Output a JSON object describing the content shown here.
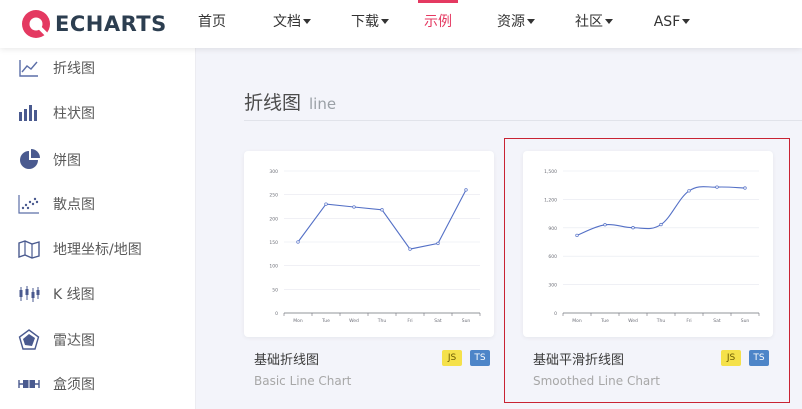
{
  "brand": {
    "name": "ECHARTS",
    "accent": "#e43961"
  },
  "nav": {
    "items": [
      {
        "label": "首页",
        "dropdown": false,
        "active": false
      },
      {
        "label": "文档",
        "dropdown": true,
        "active": false
      },
      {
        "label": "下载",
        "dropdown": true,
        "active": false
      },
      {
        "label": "示例",
        "dropdown": false,
        "active": true
      },
      {
        "label": "资源",
        "dropdown": true,
        "active": false
      },
      {
        "label": "社区",
        "dropdown": true,
        "active": false
      },
      {
        "label": "ASF",
        "dropdown": true,
        "active": false
      }
    ]
  },
  "sidebar": {
    "items": [
      {
        "label": "折线图",
        "icon": "line-chart-icon"
      },
      {
        "label": "柱状图",
        "icon": "bar-chart-icon"
      },
      {
        "label": "饼图",
        "icon": "pie-chart-icon"
      },
      {
        "label": "散点图",
        "icon": "scatter-chart-icon"
      },
      {
        "label": "地理坐标/地图",
        "icon": "map-icon"
      },
      {
        "label": "K 线图",
        "icon": "candlestick-icon"
      },
      {
        "label": "雷达图",
        "icon": "radar-chart-icon"
      },
      {
        "label": "盒须图",
        "icon": "boxplot-icon"
      }
    ]
  },
  "section": {
    "title": "折线图",
    "subtitle": "line"
  },
  "cards": [
    {
      "title": "基础折线图",
      "subtitle": "Basic Line Chart",
      "badges": [
        "JS",
        "TS"
      ],
      "chart_data": {
        "type": "line",
        "smooth": false,
        "categories": [
          "Mon",
          "Tue",
          "Wed",
          "Thu",
          "Fri",
          "Sat",
          "Sun"
        ],
        "values": [
          150,
          230,
          224,
          218,
          135,
          147,
          260
        ],
        "yticks": [
          "0",
          "50",
          "100",
          "150",
          "200",
          "250",
          "300"
        ],
        "ylim": [
          0,
          300
        ],
        "color": "#5470c6",
        "grid": true
      }
    },
    {
      "title": "基础平滑折线图",
      "subtitle": "Smoothed Line Chart",
      "badges": [
        "JS",
        "TS"
      ],
      "chart_data": {
        "type": "line",
        "smooth": true,
        "categories": [
          "Mon",
          "Tue",
          "Wed",
          "Thu",
          "Fri",
          "Sat",
          "Sun"
        ],
        "values": [
          820,
          932,
          901,
          934,
          1290,
          1330,
          1320
        ],
        "yticks": [
          "0",
          "300",
          "600",
          "900",
          "1,200",
          "1,500"
        ],
        "ylim": [
          0,
          1500
        ],
        "color": "#5470c6",
        "grid": true
      }
    }
  ]
}
